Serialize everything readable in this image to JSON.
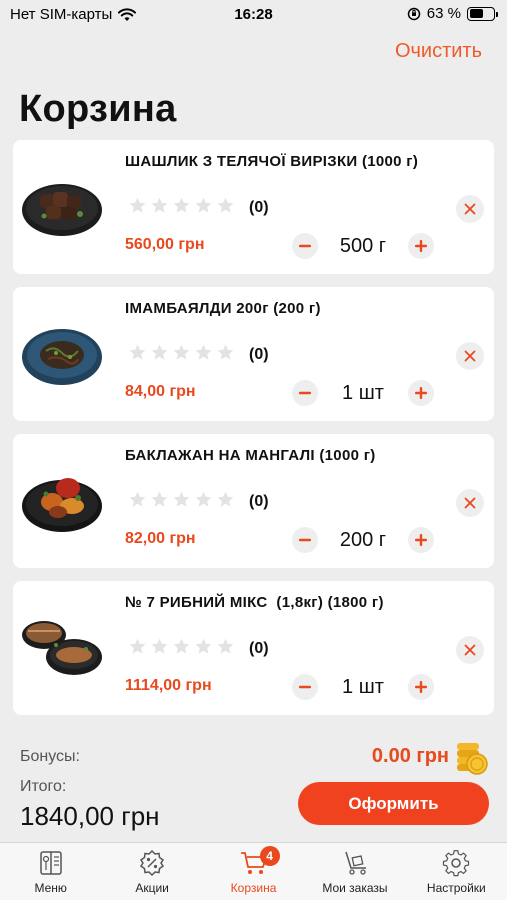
{
  "status_bar": {
    "carrier": "Нет SIM-карты",
    "time": "16:28",
    "battery": "63 %",
    "battery_level": 0.63
  },
  "header": {
    "clear_label": "Очистить",
    "title": "Корзина"
  },
  "cart": {
    "items": [
      {
        "name": "ШАШЛИК З ТЕЛЯЧОЇ ВИРІЗКИ (1000 г)",
        "reviews": "(0)",
        "rating": 0,
        "price": "560,00 грн",
        "quantity": "500 г",
        "image": "grilled-meat-dish-image"
      },
      {
        "name": "ІМАМБАЯЛДИ 200г (200 г)",
        "reviews": "(0)",
        "rating": 0,
        "price": "84,00 грн",
        "quantity": "1 шт",
        "image": "eggplant-dish-image"
      },
      {
        "name": "БАКЛАЖАН НА МАНГАЛІ (1000 г)",
        "reviews": "(0)",
        "rating": 0,
        "price": "82,00 грн",
        "quantity": "200 г",
        "image": "grilled-vegetables-image"
      },
      {
        "name": "№ 7 РИБНИЙ МІКС  (1,8кг) (1800 г)",
        "reviews": "(0)",
        "rating": 0,
        "price": "1114,00 грн",
        "quantity": "1 шт",
        "image": "fish-mix-image"
      }
    ]
  },
  "summary": {
    "bonus_label": "Бонусы:",
    "bonus_value": "0.00 грн",
    "total_label": "Итого:",
    "total_value": "1840,00 грн",
    "order_button": "Оформить"
  },
  "tab_bar": {
    "tabs": [
      {
        "label": "Меню",
        "icon": "menu-book-icon",
        "active": false
      },
      {
        "label": "Акции",
        "icon": "discount-icon",
        "active": false
      },
      {
        "label": "Корзина",
        "icon": "cart-icon",
        "active": true,
        "badge": "4"
      },
      {
        "label": "Мои заказы",
        "icon": "trolley-icon",
        "active": false
      },
      {
        "label": "Настройки",
        "icon": "gear-icon",
        "active": false
      }
    ]
  },
  "colors": {
    "accent": "#e8491d",
    "button": "#f0421f",
    "background": "#ededed",
    "card": "#ffffff"
  }
}
